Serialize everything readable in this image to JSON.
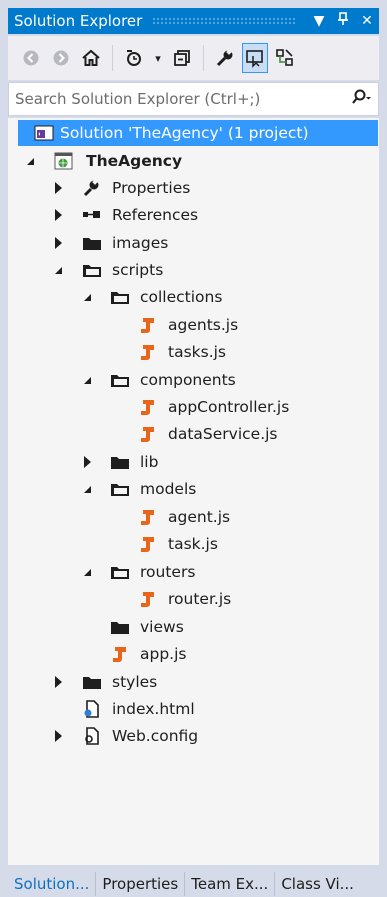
{
  "window": {
    "title": "Solution Explorer",
    "buttons": [
      "▼",
      "𝔽",
      "✕"
    ]
  },
  "search": {
    "placeholder": "Search Solution Explorer (Ctrl+;)"
  },
  "tree": {
    "solution": "Solution 'TheAgency' (1 project)",
    "project": "TheAgency",
    "properties": "Properties",
    "references": "References",
    "images": "images",
    "scripts": "scripts",
    "collections": "collections",
    "agents_js": "agents.js",
    "tasks_js": "tasks.js",
    "components": "components",
    "appController_js": "appController.js",
    "dataService_js": "dataService.js",
    "lib": "lib",
    "models": "models",
    "agent_js": "agent.js",
    "task_js": "task.js",
    "routers": "routers",
    "router_js": "router.js",
    "views": "views",
    "app_js": "app.js",
    "styles": "styles",
    "index_html": "index.html",
    "web_config": "Web.config"
  },
  "tabs": [
    "Solution...",
    "Properties",
    "Team Ex...",
    "Class Vi..."
  ],
  "colors": {
    "accent": "#007acc",
    "selection": "#3399ff",
    "js_icon": "#e8651a"
  }
}
